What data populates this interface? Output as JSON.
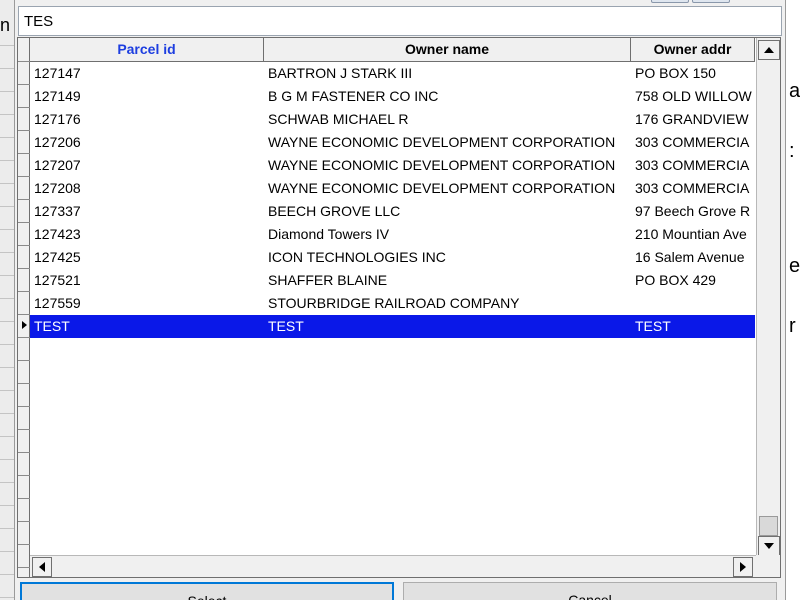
{
  "background": {
    "left_char": "n",
    "right_chars": [
      "as",
      ":",
      "e",
      "r"
    ]
  },
  "search": {
    "value": "TES",
    "placeholder": ""
  },
  "grid": {
    "columns": [
      "Parcel id",
      "Owner name",
      "Owner addr"
    ],
    "sorted_column": "Parcel id",
    "row_indicator_icon": "current-row-arrow-icon",
    "rows": [
      {
        "parcel_id": "127147",
        "owner_name": "BARTRON J STARK III",
        "owner_addr": "PO BOX 150"
      },
      {
        "parcel_id": "127149",
        "owner_name": "B G M FASTENER CO INC",
        "owner_addr": "758 OLD WILLOW"
      },
      {
        "parcel_id": "127176",
        "owner_name": "SCHWAB MICHAEL R",
        "owner_addr": "176 GRANDVIEW"
      },
      {
        "parcel_id": "127206",
        "owner_name": "WAYNE ECONOMIC DEVELOPMENT CORPORATION",
        "owner_addr": "303 COMMERCIA"
      },
      {
        "parcel_id": "127207",
        "owner_name": "WAYNE ECONOMIC DEVELOPMENT CORPORATION",
        "owner_addr": "303 COMMERCIA"
      },
      {
        "parcel_id": "127208",
        "owner_name": "WAYNE ECONOMIC DEVELOPMENT CORPORATION",
        "owner_addr": "303 COMMERCIA"
      },
      {
        "parcel_id": "127337",
        "owner_name": "BEECH GROVE LLC",
        "owner_addr": "97 Beech Grove R"
      },
      {
        "parcel_id": "127423",
        "owner_name": "Diamond Towers IV",
        "owner_addr": "210 Mountian Ave"
      },
      {
        "parcel_id": "127425",
        "owner_name": "ICON TECHNOLOGIES INC",
        "owner_addr": "16 Salem Avenue"
      },
      {
        "parcel_id": "127521",
        "owner_name": "SHAFFER BLAINE",
        "owner_addr": "PO BOX 429"
      },
      {
        "parcel_id": "127559",
        "owner_name": "STOURBRIDGE RAILROAD COMPANY",
        "owner_addr": ""
      },
      {
        "parcel_id": "TEST",
        "owner_name": "TEST",
        "owner_addr": "TEST"
      }
    ],
    "selected_row_index": 11
  },
  "buttons": {
    "select_label": "Select",
    "cancel_label": "Cancel"
  },
  "colors": {
    "selection": "#0a18e8",
    "sorted_header": "#1d3ee0",
    "primary_button_border": "#0078d7"
  }
}
